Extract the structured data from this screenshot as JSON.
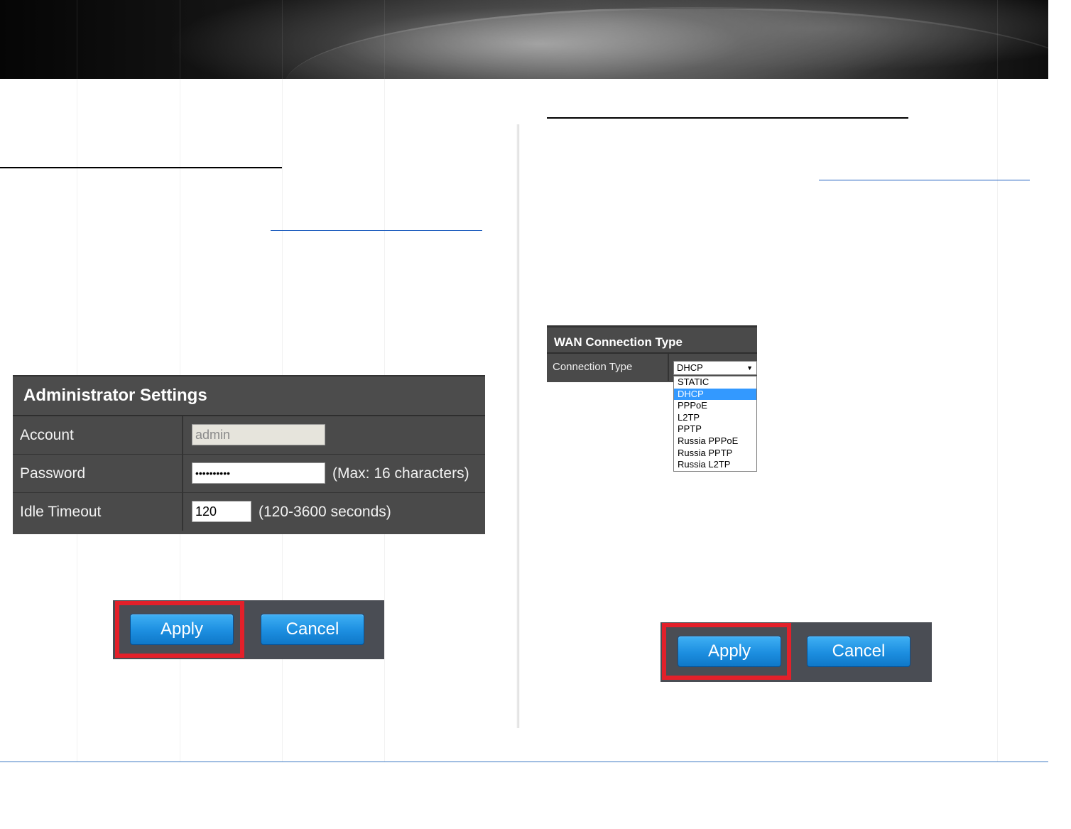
{
  "admin_settings": {
    "title": "Administrator Settings",
    "rows": [
      {
        "label": "Account",
        "value": "admin",
        "hint": ""
      },
      {
        "label": "Password",
        "value": "••••••••••",
        "hint": "(Max: 16 characters)"
      },
      {
        "label": "Idle Timeout",
        "value": "120",
        "hint": "(120-3600 seconds)"
      }
    ]
  },
  "left_buttons": {
    "apply": "Apply",
    "cancel": "Cancel"
  },
  "wan": {
    "title": "WAN Connection Type",
    "row_label": "Connection Type",
    "selected": "DHCP",
    "options": [
      "STATIC",
      "DHCP",
      "PPPoE",
      "L2TP",
      "PPTP",
      "Russia PPPoE",
      "Russia PPTP",
      "Russia L2TP"
    ]
  },
  "right_buttons": {
    "apply": "Apply",
    "cancel": "Cancel"
  },
  "colors": {
    "highlight": "#e3202a",
    "button": "#1c8ee0",
    "panel": "#4a4a4a"
  }
}
